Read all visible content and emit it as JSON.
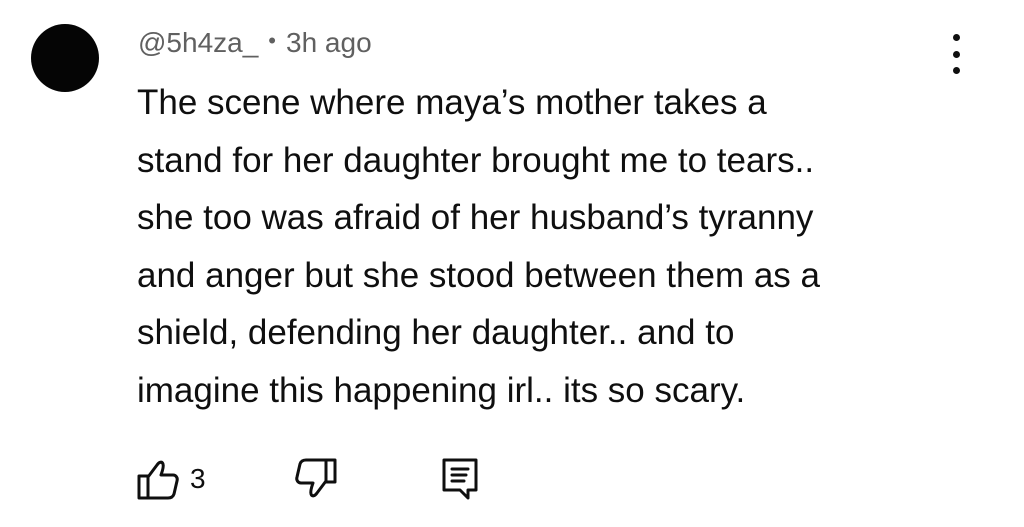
{
  "comment": {
    "author": "@5h4za_",
    "separator": "•",
    "time_ago": "3h ago",
    "text_lines": [
      "The scene where maya’s mother takes a",
      "stand for her daughter brought me to tears..",
      "she too was afraid of her husband’s tyranny",
      "and anger but she stood between them as a",
      "shield, defending her daughter.. and to",
      "imagine this happening irl.. its so scary."
    ],
    "like_count": "3"
  },
  "icons": {
    "more": "more-vert-icon",
    "like": "thumb-up-icon",
    "dislike": "thumb-down-icon",
    "reply": "reply-comment-icon"
  }
}
